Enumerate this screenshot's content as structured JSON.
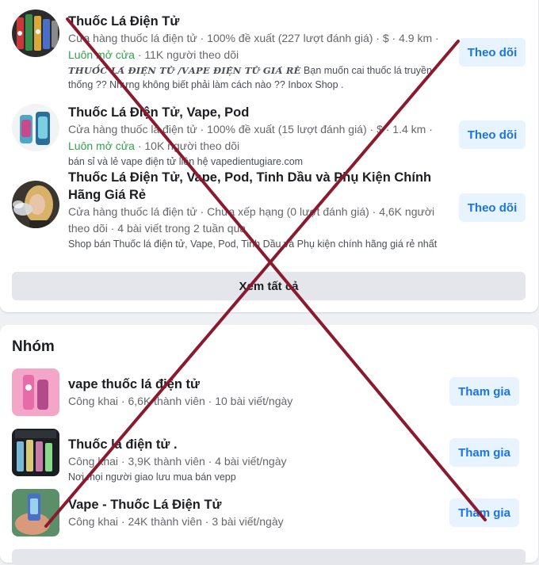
{
  "colors": {
    "accent": "#1b74e4",
    "button_bg": "#e7f3ff",
    "open_status": "#31a24c",
    "overlay_x": "#8b1a2e"
  },
  "pages": {
    "items": [
      {
        "title": "Thuốc Lá Điện Tử",
        "meta_line1": "Cửa hàng thuốc lá điện tử · 100% đề xuất (227 lượt đánh giá) · $ · 4.9 km ·",
        "open_status": "Luôn mở cửa",
        "meta_line2_rest": " · 11K người theo dõi",
        "desc_bold": "𝑻𝑯𝑼𝑶̂́𝑪 𝑳𝑨́ Đ𝑰𝑬̣̂𝑵 𝑻𝑼̛̉ /𝑽𝑨𝑷𝑬 Đ𝑰𝑬̣̂𝑵 𝑻𝑼̛̉ 𝑮𝑰𝑨́ 𝑹𝑬̉",
        "desc_line1_rest": " Bạn muốn cai thuốc lá truyền",
        "desc_line2": "thống ?? Nhưng không biết phải làm cách nào ?? Inbox Shop .",
        "button": "Theo dõi",
        "icon": "vape-devices-thumbnail"
      },
      {
        "title": "Thuốc Lá Điện Tử, Vape, Pod",
        "meta_line1": "Cửa hàng thuốc lá điện tử · 100% đề xuất (15 lượt đánh giá) · $ · 1.4 km ·",
        "open_status": "Luôn mở cửa",
        "meta_line2_rest": " · 10K người theo dõi",
        "desc": "bán sỉ và lẻ vape điện tử liên hệ vapedientugiare.com",
        "button": "Theo dõi",
        "icon": "pod-device-thumbnail"
      },
      {
        "title_line1": "Thuốc Lá Điện Tử, Vape, Pod, Tinh Dầu và Phụ Kiện Chính",
        "title_line2": "Hãng Giá Rẻ",
        "meta_line1": "Cửa hàng thuốc lá điện tử · Chưa xếp hạng (0 lượt đánh giá) · 4,6K người",
        "meta_line2": "theo dõi · 4 bài viết trong 2 tuần qua",
        "desc": "Shop bán Thuốc lá điện tử, Vape, Pod, Tinh Dầu và Phụ kiện chính hãng giá rẻ nhất",
        "button": "Theo dõi",
        "icon": "woman-vaping-thumbnail"
      }
    ],
    "see_all": "Xem tất cả"
  },
  "groups": {
    "heading": "Nhóm",
    "items": [
      {
        "title": "vape thuốc lá điện tử",
        "meta": "Công khai · 6,6K thành viên · 10 bài viết/ngày",
        "button": "Tham gia",
        "icon": "pink-vape-thumbnail"
      },
      {
        "title": "Thuốc lá điện tử .",
        "meta": "Công khai · 3,9K thành viên · 4 bài viết/ngày",
        "desc": "Nơi mọi người giao lưu mua bán vepp",
        "button": "Tham gia",
        "icon": "ninja-vape-thumbnail"
      },
      {
        "title": "Vape - Thuốc Lá Điện Tử",
        "meta": "Công khai · 24K thành viên · 3 bài viết/ngày",
        "button": "Tham gia",
        "icon": "hand-vape-thumbnail"
      }
    ]
  }
}
